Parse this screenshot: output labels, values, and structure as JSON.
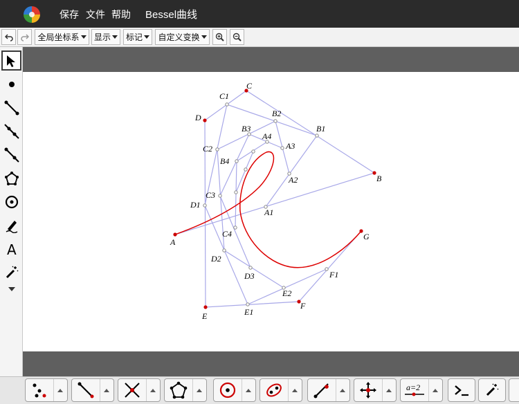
{
  "menubar": {
    "save": "保存",
    "file": "文件",
    "help": "帮助",
    "title": "Bessel曲线"
  },
  "toolbar": {
    "coord_system": "全局坐标系",
    "display": "显示",
    "mark": "标记",
    "custom_transform": "自定义变换"
  },
  "bottom_tools": {
    "formula_label": "a=2"
  },
  "labels": {
    "A": "A",
    "B": "B",
    "C": "C",
    "D": "D",
    "E": "E",
    "F": "F",
    "G": "G",
    "A1": "A1",
    "A2": "A2",
    "A3": "A3",
    "A4": "A4",
    "B1": "B1",
    "B2": "B2",
    "B3": "B3",
    "B4": "B4",
    "C1": "C1",
    "C2": "C2",
    "C3": "C3",
    "C4": "C4",
    "D1": "D1",
    "D2": "D2",
    "D3": "D3",
    "E1": "E1",
    "E2": "E2",
    "F1": "F1"
  },
  "colors": {
    "curve": "#dd0000",
    "hull": "#a8a8e8",
    "titlebar": "#2b2b2b",
    "panel": "#5f5f5f"
  }
}
